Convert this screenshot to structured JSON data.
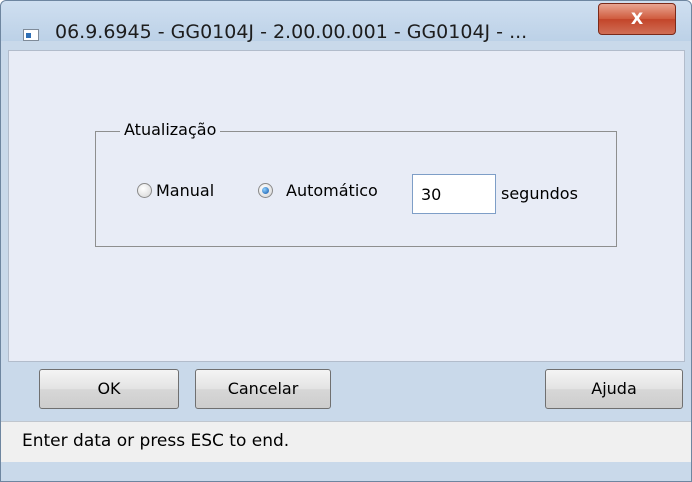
{
  "window": {
    "title": "06.9.6945 - GG0104J - 2.00.00.001 - GG0104J - ...",
    "close_label": "X"
  },
  "group": {
    "label": "Atualização",
    "options": [
      {
        "label": "Manual",
        "selected": false
      },
      {
        "label": "Automático",
        "selected": true
      }
    ],
    "interval_value": "30",
    "interval_unit": "segundos"
  },
  "buttons": {
    "ok": "OK",
    "cancel": "Cancelar",
    "help": "Ajuda"
  },
  "status": {
    "text": "Enter data or press ESC to end."
  }
}
